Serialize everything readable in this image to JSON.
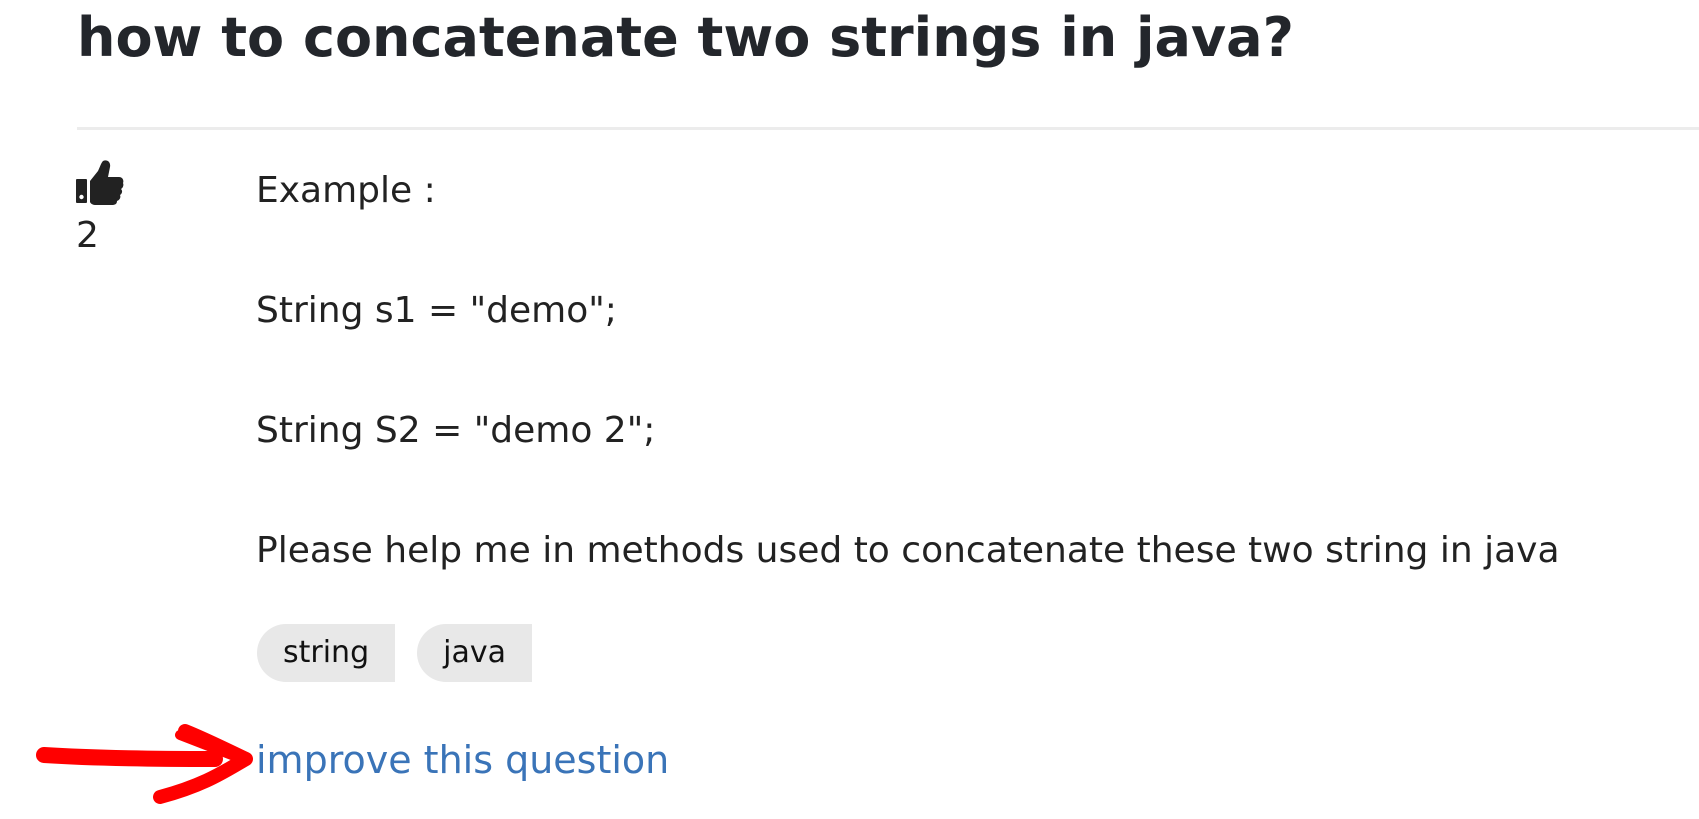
{
  "question": {
    "title": "how to concatenate two strings in java?",
    "votes": "2",
    "body": [
      "Example :",
      "String s1 = \"demo\";",
      "String S2 = \"demo 2\";",
      "Please help me in methods used to concatenate these two string in java"
    ],
    "tags": [
      "string",
      "java"
    ],
    "improve_link": "improve this question"
  },
  "icons": {
    "vote": "thumbs-up-icon",
    "annotation": "red-arrow-annotation"
  },
  "colors": {
    "link": "#3a74b8",
    "annotation": "#ff0000",
    "tag_bg": "#e8e8e8"
  }
}
